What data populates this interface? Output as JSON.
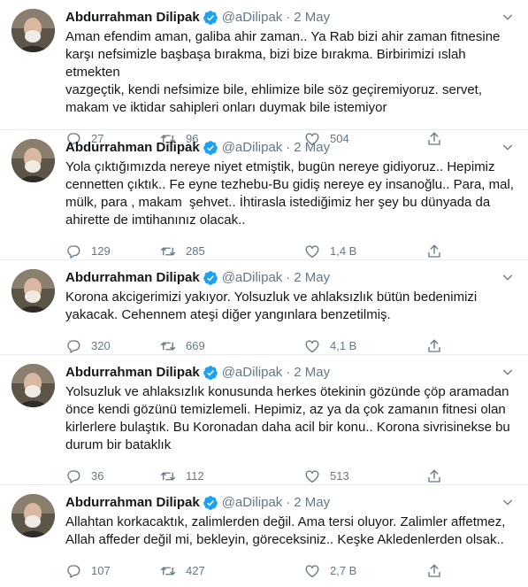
{
  "colors": {
    "accent": "#1da1f2",
    "text_primary": "#14171a",
    "text_secondary": "#657786",
    "divider": "#e6ecf0"
  },
  "icons": {
    "verified": "verified-badge-icon",
    "caret": "chevron-down-icon",
    "reply": "reply-icon",
    "retweet": "retweet-icon",
    "like": "heart-icon",
    "share": "share-icon"
  },
  "tweets": [
    {
      "name": "Abdurrahman Dilipak",
      "handle": "@aDilipak",
      "separator": "·",
      "time": "2 May",
      "text": "Aman efendim aman, galiba ahir zaman.. Ya Rab bizi ahir zaman fitnesine\nkarşı nefsimizle başbaşa bırakma, bizi bize bırakma. Birbirimizi ıslah etmekten\nvazgeçtik, kendi nefsimize bile, ehlimize bile söz geçiremiyoruz. servet,\nmakam ve iktidar sahipleri onları duymak bile istemiyor",
      "replies": "27",
      "retweets": "96",
      "likes": "504"
    },
    {
      "name": "Abdurrahman Dilipak",
      "handle": "@aDilipak",
      "separator": "·",
      "time": "2 May",
      "text": "Yola çıktığımızda nereye niyet etmiştik, bugün nereye gidiyoruz.. Hepimiz\ncennetten çıktık.. Fe eyne tezhebu-Bu gidiş nereye ey insanoğlu.. Para, mal,\nmülk, para , makam  şehvet.. İhtirasla istediğimiz her şey bu dünyada da\nahirette de imtihanınız olacak..",
      "replies": "129",
      "retweets": "285",
      "likes": "1,4 B"
    },
    {
      "name": "Abdurrahman Dilipak",
      "handle": "@aDilipak",
      "separator": "·",
      "time": "2 May",
      "text": "Korona akcigerimizi yakıyor. Yolsuzluk ve ahlaksızlık bütün bedenimizi\nyakacak. Cehennem ateşi diğer yangınlara benzetilmiş.",
      "replies": "320",
      "retweets": "669",
      "likes": "4,1 B"
    },
    {
      "name": "Abdurrahman Dilipak",
      "handle": "@aDilipak",
      "separator": "·",
      "time": "2 May",
      "text": "Yolsuzluk ve ahlaksızlık konusunda herkes ötekinin gözünde çöp aramadan\nönce kendi gözünü temizlemeli. Hepimiz, az ya da çok zamanın fitnesi olan\nkirlerlere bulaştık. Bu Koronadan daha acil bir konu.. Korona sivrisinekse bu\ndurum bir bataklık",
      "replies": "36",
      "retweets": "112",
      "likes": "513"
    },
    {
      "name": "Abdurrahman Dilipak",
      "handle": "@aDilipak",
      "separator": "·",
      "time": "2 May",
      "text": "Allahtan korkacaktık, zalimlerden değil. Ama tersi oluyor. Zalimler affetmez,\nAllah affeder değil mi, bekleyin, göreceksiniz.. Keşke Akledenlerden olsak..",
      "replies": "107",
      "retweets": "427",
      "likes": "2,7 B"
    }
  ]
}
